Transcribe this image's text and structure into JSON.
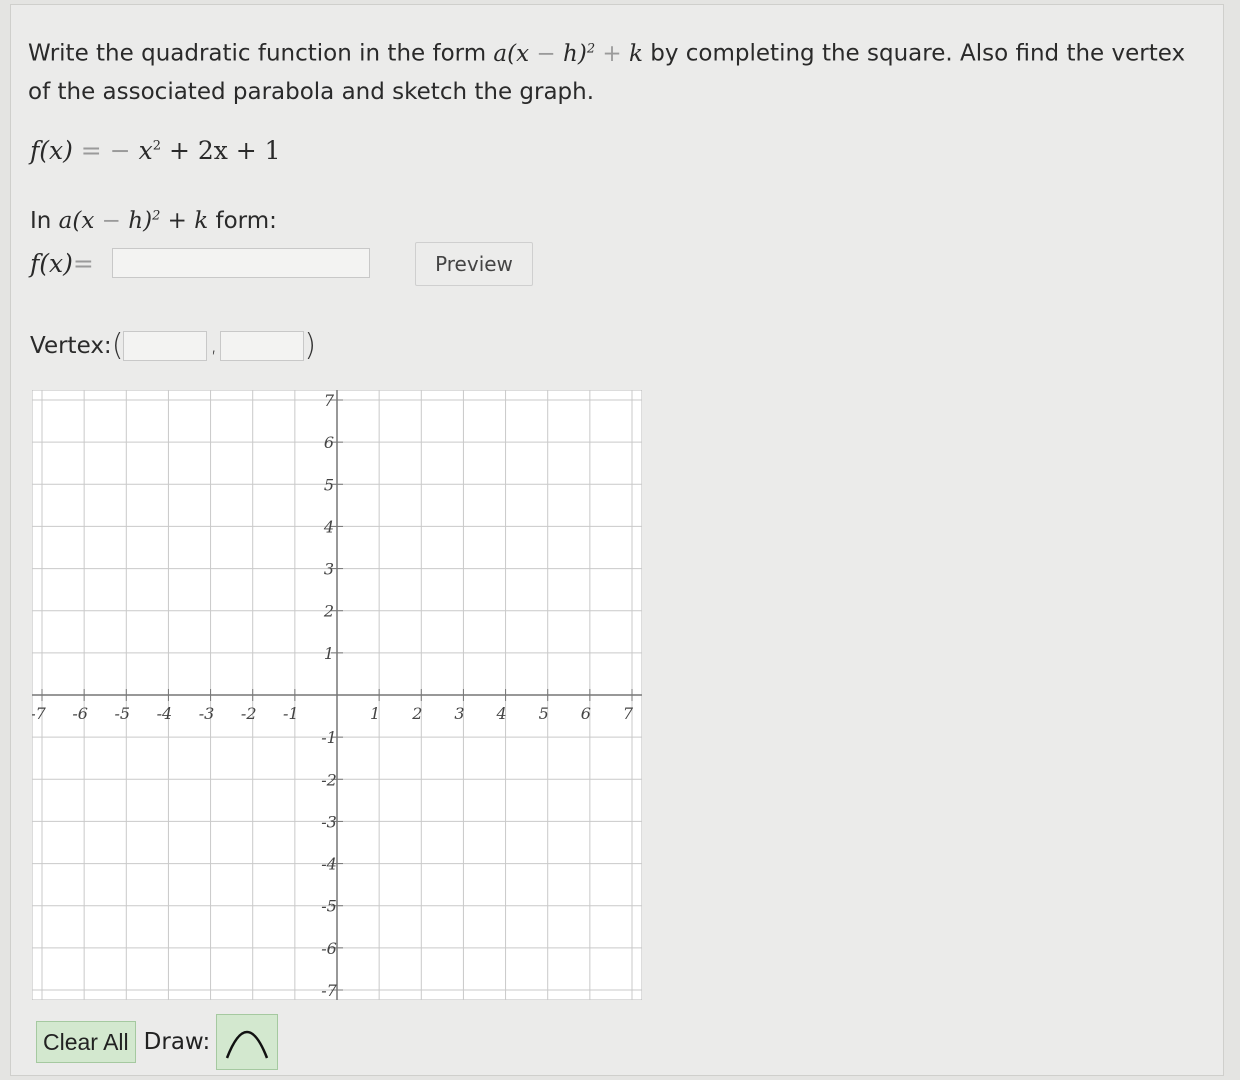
{
  "question": {
    "text_before": "Write the quadratic function in the form",
    "form_a": "a",
    "form_open": "(",
    "form_x": "x",
    "form_minus": " − ",
    "form_h": "h",
    "form_close": ")",
    "form_exp": "2",
    "form_plus": " + ",
    "form_k": "k",
    "text_after": "by completing the square. Also find the vertex of the associated parabola and sketch the graph."
  },
  "function": {
    "lhs": "f(x)",
    "equals": " = ",
    "rhs_minus": "− ",
    "rhs_x": "x",
    "rhs_exp": "2",
    "rhs_rest": " + 2x + 1"
  },
  "form_label": {
    "prefix": "In ",
    "a": "a",
    "open": "(",
    "x": "x",
    "minus": " − ",
    "h": "h",
    "close": ")",
    "exp": "2",
    "plus": " + ",
    "k": "k",
    "suffix": " form:"
  },
  "answer": {
    "lhs": "f(x)",
    "equals": " =",
    "value": ""
  },
  "preview_label": "Preview",
  "vertex": {
    "label": "Vertex: ",
    "open": "(",
    "comma": ",",
    "close": ")",
    "x_value": "",
    "y_value": ""
  },
  "graph": {
    "x_range": [
      -7,
      7
    ],
    "y_range": [
      -7,
      7
    ],
    "grid": true,
    "x_tick_labels": [
      "-7",
      "-6",
      "-5",
      "-4",
      "-3",
      "-2",
      "-1",
      "1",
      "2",
      "3",
      "4",
      "5",
      "6",
      "7"
    ],
    "y_tick_labels": [
      "7",
      "6",
      "5",
      "4",
      "3",
      "2",
      "1",
      "-1",
      "-2",
      "-3",
      "-4",
      "-5",
      "-6",
      "-7"
    ],
    "grid_color": "#c9c9c9",
    "axis_color": "#777777",
    "background": "#ffffff"
  },
  "toolbar": {
    "clear_label": "Clear All",
    "draw_label": "Draw:",
    "draw_tool_icon": "parabola-icon",
    "accent": "#d3e8cf"
  }
}
